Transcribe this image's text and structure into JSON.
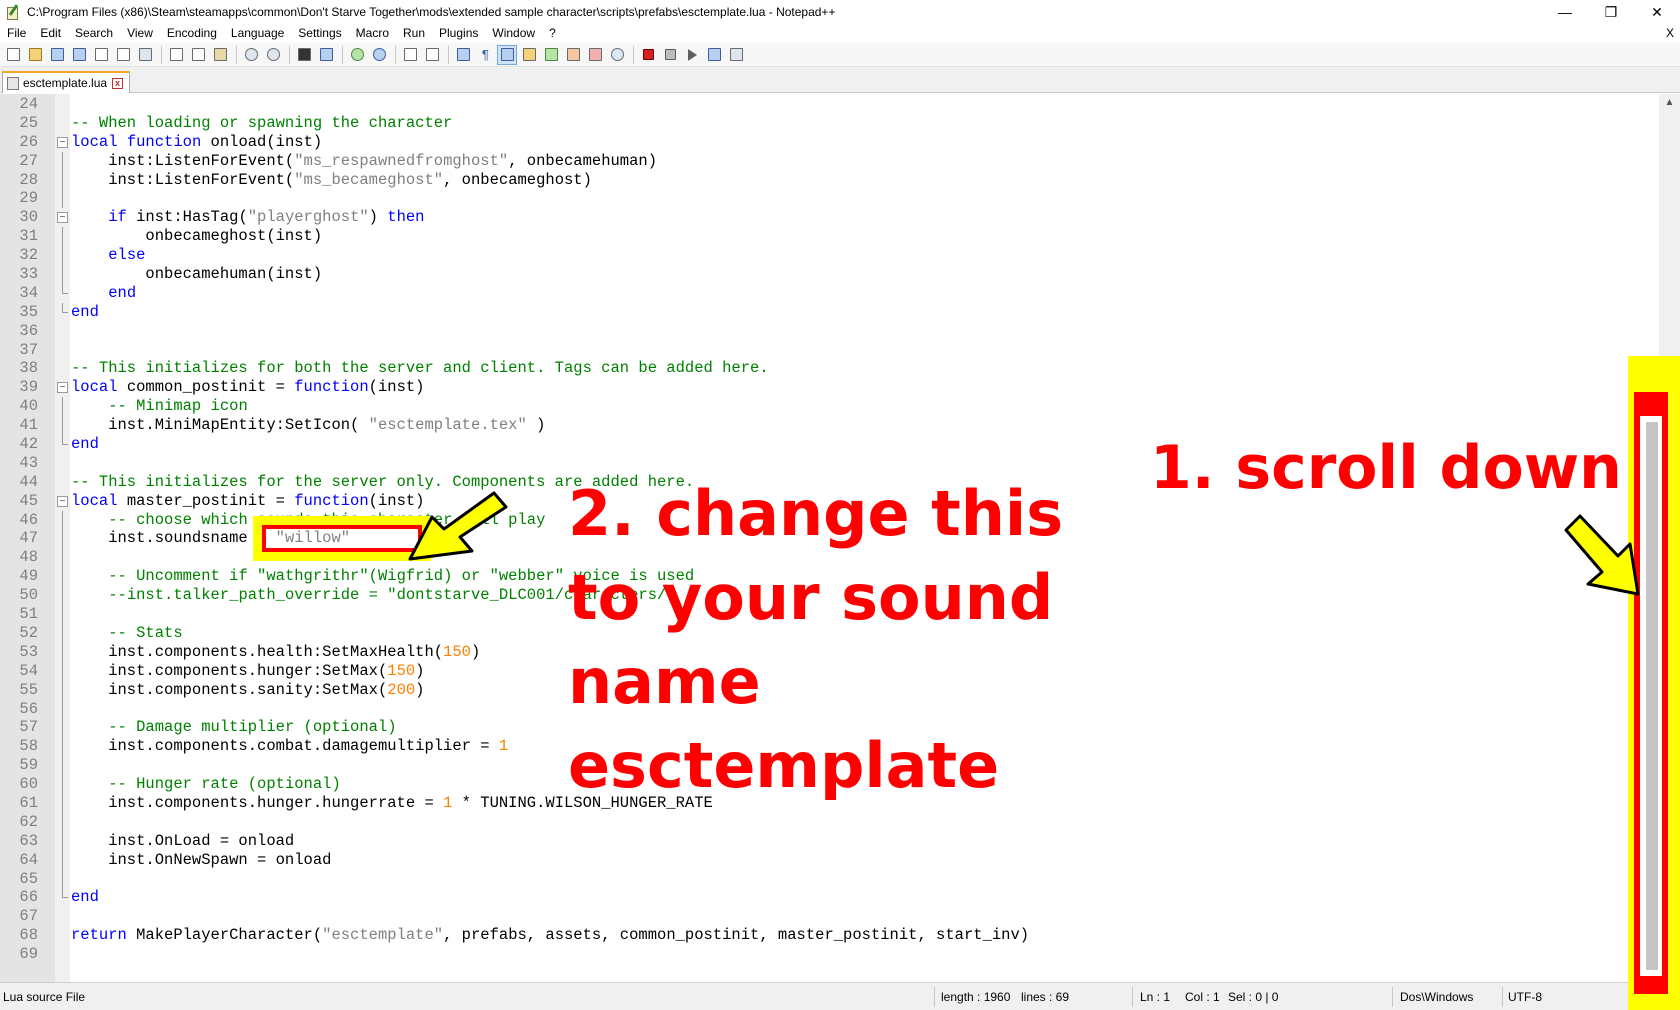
{
  "window": {
    "title": "C:\\Program Files (x86)\\Steam\\steamapps\\common\\Don't Starve Together\\mods\\extended sample character\\scripts\\prefabs\\esctemplate.lua - Notepad++",
    "minimize": "—",
    "maximize": "❐",
    "close": "✕"
  },
  "menu": {
    "items": [
      "File",
      "Edit",
      "Search",
      "View",
      "Encoding",
      "Language",
      "Settings",
      "Macro",
      "Run",
      "Plugins",
      "Window",
      "?"
    ],
    "close": "X"
  },
  "tab": {
    "label": "esctemplate.lua",
    "close": "x"
  },
  "status": {
    "filetype": "Lua source File",
    "length": "length : 1960",
    "lines": "lines : 69",
    "ln": "Ln : 1",
    "col": "Col : 1",
    "sel": "Sel : 0 | 0",
    "eol": "Dos\\Windows",
    "encoding": "UTF-8"
  },
  "annotations": {
    "step1": "1. scroll down",
    "step2_lines": [
      "2. change this",
      "to your sound",
      "name",
      "esctemplate"
    ]
  },
  "code": [
    {
      "n": "24",
      "t": []
    },
    {
      "n": "25",
      "t": [
        [
          "cm",
          "-- When loading or spawning the character"
        ]
      ]
    },
    {
      "n": "26",
      "fold": "open",
      "t": [
        [
          "kw",
          "local"
        ],
        [
          "",
          " "
        ],
        [
          "kw",
          "function"
        ],
        [
          "",
          " onload(inst)"
        ]
      ]
    },
    {
      "n": "27",
      "t": [
        [
          "",
          "    inst:ListenForEvent("
        ],
        [
          "st",
          "\"ms_respawnedfromghost\""
        ],
        [
          "",
          ", onbecamehuman)"
        ]
      ]
    },
    {
      "n": "28",
      "t": [
        [
          "",
          "    inst:ListenForEvent("
        ],
        [
          "st",
          "\"ms_becameghost\""
        ],
        [
          "",
          ", onbecameghost)"
        ]
      ]
    },
    {
      "n": "29",
      "t": []
    },
    {
      "n": "30",
      "fold": "open",
      "t": [
        [
          "",
          "    "
        ],
        [
          "kw",
          "if"
        ],
        [
          "",
          " inst:HasTag("
        ],
        [
          "st",
          "\"playerghost\""
        ],
        [
          "",
          ") "
        ],
        [
          "kw",
          "then"
        ]
      ]
    },
    {
      "n": "31",
      "t": [
        [
          "",
          "        onbecameghost(inst)"
        ]
      ]
    },
    {
      "n": "32",
      "t": [
        [
          "",
          "    "
        ],
        [
          "kw",
          "else"
        ]
      ]
    },
    {
      "n": "33",
      "t": [
        [
          "",
          "        onbecamehuman(inst)"
        ]
      ]
    },
    {
      "n": "34",
      "fold": "end",
      "t": [
        [
          "",
          "    "
        ],
        [
          "kw",
          "end"
        ]
      ]
    },
    {
      "n": "35",
      "fold": "end",
      "t": [
        [
          "kw",
          "end"
        ]
      ]
    },
    {
      "n": "36",
      "t": []
    },
    {
      "n": "37",
      "t": []
    },
    {
      "n": "38",
      "t": [
        [
          "cm",
          "-- This initializes for both the server and client. Tags can be added here."
        ]
      ]
    },
    {
      "n": "39",
      "fold": "open",
      "t": [
        [
          "kw",
          "local"
        ],
        [
          "",
          " common_postinit = "
        ],
        [
          "kw",
          "function"
        ],
        [
          "",
          "(inst)"
        ]
      ]
    },
    {
      "n": "40",
      "t": [
        [
          "",
          "    "
        ],
        [
          "cm",
          "-- Minimap icon"
        ]
      ]
    },
    {
      "n": "41",
      "t": [
        [
          "",
          "    inst.MiniMapEntity:SetIcon( "
        ],
        [
          "st",
          "\"esctemplate.tex\""
        ],
        [
          "",
          " )"
        ]
      ]
    },
    {
      "n": "42",
      "fold": "end",
      "t": [
        [
          "kw",
          "end"
        ]
      ]
    },
    {
      "n": "43",
      "t": []
    },
    {
      "n": "44",
      "t": [
        [
          "cm",
          "-- This initializes for the server only. Components are added here."
        ]
      ]
    },
    {
      "n": "45",
      "fold": "open",
      "t": [
        [
          "kw",
          "local"
        ],
        [
          "",
          " master_postinit = "
        ],
        [
          "kw",
          "function"
        ],
        [
          "",
          "(inst)"
        ]
      ]
    },
    {
      "n": "46",
      "t": [
        [
          "",
          "    "
        ],
        [
          "cm",
          "-- choose which sounds this character will play"
        ]
      ]
    },
    {
      "n": "47",
      "t": [
        [
          "",
          "    inst.soundsname = "
        ],
        [
          "st",
          "\"willow\""
        ]
      ]
    },
    {
      "n": "48",
      "t": []
    },
    {
      "n": "49",
      "t": [
        [
          "",
          "    "
        ],
        [
          "cm",
          "-- Uncomment if \"wathgrithr\"(Wigfrid) or \"webber\" voice is used"
        ]
      ]
    },
    {
      "n": "50",
      "t": [
        [
          "",
          "    "
        ],
        [
          "cm",
          "--inst.talker_path_override = \"dontstarve_DLC001/characters/\""
        ]
      ]
    },
    {
      "n": "51",
      "t": []
    },
    {
      "n": "52",
      "t": [
        [
          "",
          "    "
        ],
        [
          "cm",
          "-- Stats"
        ]
      ]
    },
    {
      "n": "53",
      "t": [
        [
          "",
          "    inst.components.health:SetMaxHealth("
        ],
        [
          "nm",
          "150"
        ],
        [
          "",
          ")"
        ]
      ]
    },
    {
      "n": "54",
      "t": [
        [
          "",
          "    inst.components.hunger:SetMax("
        ],
        [
          "nm",
          "150"
        ],
        [
          "",
          ")"
        ]
      ]
    },
    {
      "n": "55",
      "t": [
        [
          "",
          "    inst.components.sanity:SetMax("
        ],
        [
          "nm",
          "200"
        ],
        [
          "",
          ")"
        ]
      ]
    },
    {
      "n": "56",
      "t": []
    },
    {
      "n": "57",
      "t": [
        [
          "",
          "    "
        ],
        [
          "cm",
          "-- Damage multiplier (optional)"
        ]
      ]
    },
    {
      "n": "58",
      "t": [
        [
          "",
          "    inst.components.combat.damagemultiplier = "
        ],
        [
          "nm",
          "1"
        ]
      ]
    },
    {
      "n": "59",
      "t": []
    },
    {
      "n": "60",
      "t": [
        [
          "",
          "    "
        ],
        [
          "cm",
          "-- Hunger rate (optional)"
        ]
      ]
    },
    {
      "n": "61",
      "t": [
        [
          "",
          "    inst.components.hunger.hungerrate = "
        ],
        [
          "nm",
          "1"
        ],
        [
          "",
          " * TUNING.WILSON_HUNGER_RATE"
        ]
      ]
    },
    {
      "n": "62",
      "t": []
    },
    {
      "n": "63",
      "t": [
        [
          "",
          "    inst.OnLoad = onload"
        ]
      ]
    },
    {
      "n": "64",
      "t": [
        [
          "",
          "    inst.OnNewSpawn = onload"
        ]
      ]
    },
    {
      "n": "65",
      "t": []
    },
    {
      "n": "66",
      "fold": "end",
      "t": [
        [
          "kw",
          "end"
        ]
      ]
    },
    {
      "n": "67",
      "t": []
    },
    {
      "n": "68",
      "t": [
        [
          "kw",
          "return"
        ],
        [
          "",
          " MakePlayerCharacter("
        ],
        [
          "st",
          "\"esctemplate\""
        ],
        [
          "",
          ", prefabs, assets, common_postinit, master_postinit, start_inv)"
        ]
      ]
    },
    {
      "n": "69",
      "t": []
    }
  ],
  "colors": {
    "keyword": "#0000ff",
    "comment": "#008000",
    "string": "#808080",
    "number": "#ff8000",
    "annotation_red": "#ff0000",
    "annotation_yellow": "#ffff00"
  }
}
